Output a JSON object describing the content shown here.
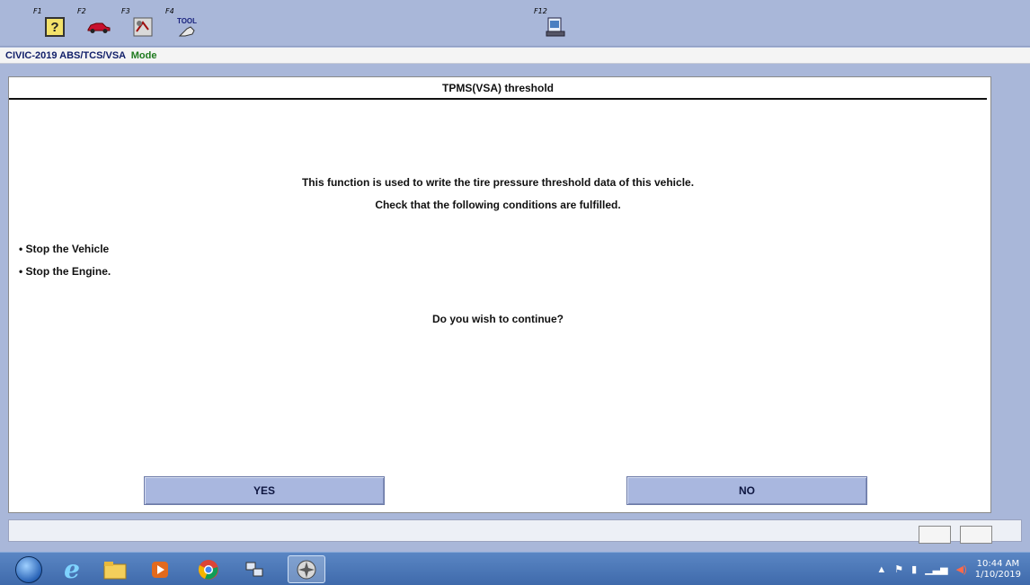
{
  "toolbar": {
    "buttons": [
      {
        "key": "F1",
        "icon": "help-icon"
      },
      {
        "key": "F2",
        "icon": "car-icon"
      },
      {
        "key": "F3",
        "icon": "service-icon"
      },
      {
        "key": "F4",
        "icon": "tool-icon"
      },
      {
        "key": "F12",
        "icon": "print-icon"
      }
    ],
    "tool_text": "TOOL"
  },
  "modebar": {
    "vehicle": "CIVIC-2019",
    "system": "ABS/TCS/VSA",
    "mode": "Mode"
  },
  "panel": {
    "title": "TPMS(VSA) threshold",
    "message_line1": "This function is used to write the tire pressure threshold data of this vehicle.",
    "message_line2": "Check that the following conditions are fulfilled.",
    "conditions": [
      "• Stop the Vehicle",
      "• Stop the Engine."
    ],
    "question": "Do you wish to continue?",
    "yes_label": "YES",
    "no_label": "NO"
  },
  "taskbar": {
    "time": "10:44 AM",
    "date": "1/10/2019"
  },
  "colors": {
    "background": "#a9b7d9",
    "button": "#a9b7df",
    "mode_green": "#1f7a1f"
  }
}
